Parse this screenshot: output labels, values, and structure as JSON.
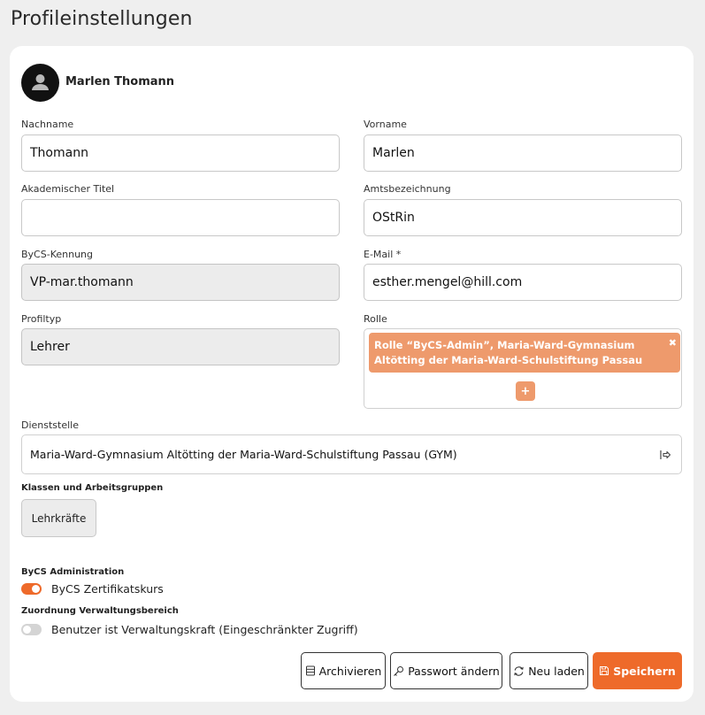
{
  "page": {
    "title": "Profileinstellungen"
  },
  "profile": {
    "display_name": "Marlen Thomann",
    "avatar_icon": "user-silhouette-icon"
  },
  "fields": {
    "nachname": {
      "label": "Nachname",
      "value": "Thomann"
    },
    "vorname": {
      "label": "Vorname",
      "value": "Marlen"
    },
    "titel": {
      "label": "Akademischer Titel",
      "value": ""
    },
    "amtsbezeichnung": {
      "label": "Amtsbezeichnung",
      "value": "OStRin"
    },
    "kennung": {
      "label": "ByCS-Kennung",
      "value": "VP-mar.thomann",
      "disabled": true
    },
    "email": {
      "label": "E-Mail *",
      "value": "esther.mengel@hill.com"
    },
    "profiltyp": {
      "label": "Profiltyp",
      "value": "Lehrer",
      "disabled": true
    },
    "rolle": {
      "label": "Rolle",
      "chips": [
        {
          "text": "Rolle “ByCS-Admin”, Maria-Ward-Gymnasium Altötting der Maria-Ward-Schulstiftung Passau",
          "close_icon": "close-icon"
        }
      ],
      "add_label": "+"
    },
    "dienststelle": {
      "label": "Dienststelle",
      "value": "Maria-Ward-Gymnasium Altötting der Maria-Ward-Schulstiftung Passau (GYM)",
      "icon": "goto-arrow-icon"
    }
  },
  "groups": {
    "label": "Klassen und Arbeitsgruppen",
    "items": [
      "Lehrkräfte"
    ]
  },
  "administration": {
    "label": "ByCS Administration",
    "toggle": {
      "label": "ByCS Zertifikatskurs",
      "on": true
    }
  },
  "verwaltung": {
    "label": "Zuordnung Verwaltungsbereich",
    "toggle": {
      "label": "Benutzer ist Verwaltungskraft (Eingeschränkter Zugriff)",
      "on": false
    }
  },
  "actions": {
    "archive": {
      "label": "Archivieren",
      "icon": "archive-icon"
    },
    "password": {
      "label": "Passwort ändern",
      "icon": "key-icon"
    },
    "reload": {
      "label": "Neu laden",
      "icon": "refresh-icon"
    },
    "save": {
      "label": "Speichern",
      "icon": "save-icon"
    }
  },
  "colors": {
    "accent": "#ee6a2a",
    "chip": "#ee9a6c",
    "disabled_bg": "#ececec",
    "page_bg": "#efefef"
  }
}
